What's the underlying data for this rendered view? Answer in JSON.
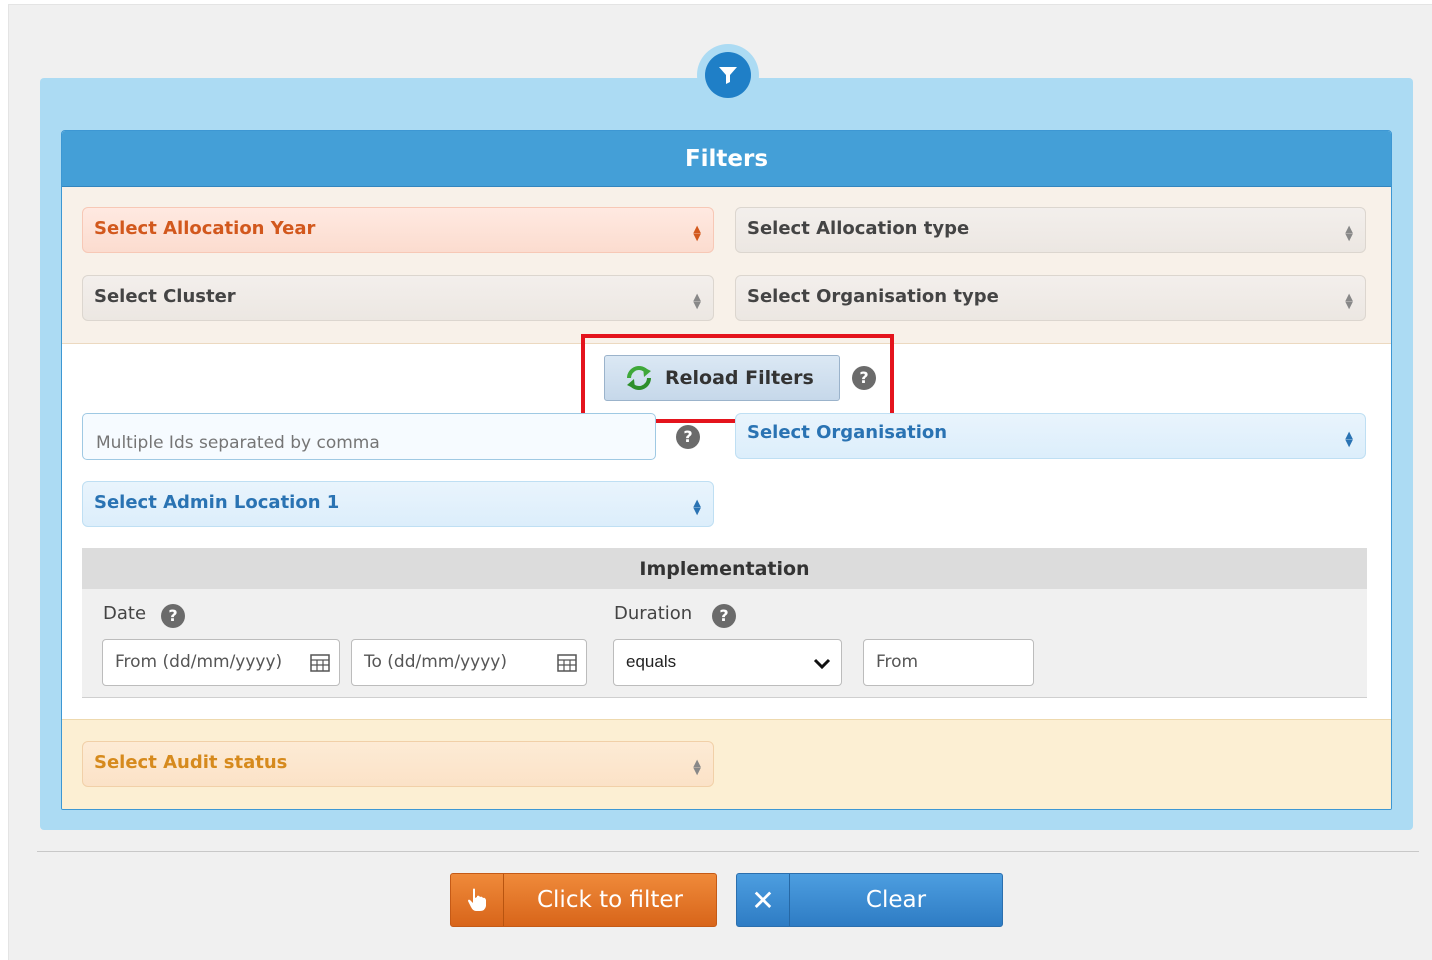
{
  "panel": {
    "title": "Filters",
    "funnel_icon": "funnel-icon"
  },
  "selects": {
    "allocation_year": "Select Allocation Year",
    "allocation_type": "Select Allocation type",
    "cluster": "Select Cluster",
    "organisation_type": "Select Organisation type",
    "organisation": "Select Organisation",
    "admin_location_1": "Select Admin Location 1",
    "audit_status": "Select Audit status",
    "arrows": "▲▼"
  },
  "reload": {
    "label": "Reload Filters",
    "icon": "refresh-icon"
  },
  "help_glyph": "?",
  "ids_input": {
    "placeholder": "Multiple Ids separated by comma",
    "value": ""
  },
  "implementation": {
    "title": "Implementation",
    "date_label": "Date",
    "duration_label": "Duration",
    "date_from_placeholder": "From (dd/mm/yyyy)",
    "date_to_placeholder": "To (dd/mm/yyyy)",
    "duration_operator": "equals",
    "duration_from_placeholder": "From"
  },
  "buttons": {
    "filter_label": "Click to filter",
    "filter_icon": "hand-pointer-icon",
    "clear_label": "Clear",
    "clear_icon": "close-icon",
    "clear_glyph": "✕"
  },
  "colors": {
    "header_blue": "#449fd7",
    "highlight_red": "#e4141d",
    "filter_orange": "#e27628",
    "clear_blue": "#3d8ed4"
  }
}
